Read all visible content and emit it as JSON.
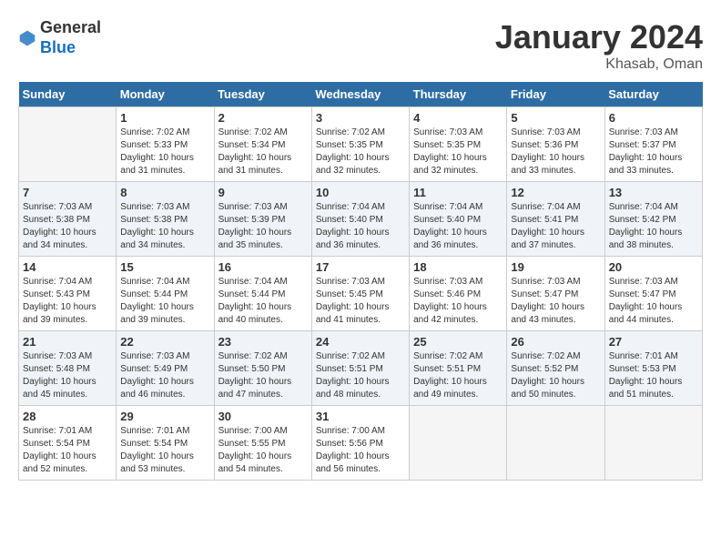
{
  "header": {
    "logo_line1": "General",
    "logo_line2": "Blue",
    "month_year": "January 2024",
    "location": "Khasab, Oman"
  },
  "days_of_week": [
    "Sunday",
    "Monday",
    "Tuesday",
    "Wednesday",
    "Thursday",
    "Friday",
    "Saturday"
  ],
  "weeks": [
    [
      {
        "day": "",
        "sunrise": "",
        "sunset": "",
        "daylight": ""
      },
      {
        "day": "1",
        "sunrise": "Sunrise: 7:02 AM",
        "sunset": "Sunset: 5:33 PM",
        "daylight": "Daylight: 10 hours and 31 minutes."
      },
      {
        "day": "2",
        "sunrise": "Sunrise: 7:02 AM",
        "sunset": "Sunset: 5:34 PM",
        "daylight": "Daylight: 10 hours and 31 minutes."
      },
      {
        "day": "3",
        "sunrise": "Sunrise: 7:02 AM",
        "sunset": "Sunset: 5:35 PM",
        "daylight": "Daylight: 10 hours and 32 minutes."
      },
      {
        "day": "4",
        "sunrise": "Sunrise: 7:03 AM",
        "sunset": "Sunset: 5:35 PM",
        "daylight": "Daylight: 10 hours and 32 minutes."
      },
      {
        "day": "5",
        "sunrise": "Sunrise: 7:03 AM",
        "sunset": "Sunset: 5:36 PM",
        "daylight": "Daylight: 10 hours and 33 minutes."
      },
      {
        "day": "6",
        "sunrise": "Sunrise: 7:03 AM",
        "sunset": "Sunset: 5:37 PM",
        "daylight": "Daylight: 10 hours and 33 minutes."
      }
    ],
    [
      {
        "day": "7",
        "sunrise": "Sunrise: 7:03 AM",
        "sunset": "Sunset: 5:38 PM",
        "daylight": "Daylight: 10 hours and 34 minutes."
      },
      {
        "day": "8",
        "sunrise": "Sunrise: 7:03 AM",
        "sunset": "Sunset: 5:38 PM",
        "daylight": "Daylight: 10 hours and 34 minutes."
      },
      {
        "day": "9",
        "sunrise": "Sunrise: 7:03 AM",
        "sunset": "Sunset: 5:39 PM",
        "daylight": "Daylight: 10 hours and 35 minutes."
      },
      {
        "day": "10",
        "sunrise": "Sunrise: 7:04 AM",
        "sunset": "Sunset: 5:40 PM",
        "daylight": "Daylight: 10 hours and 36 minutes."
      },
      {
        "day": "11",
        "sunrise": "Sunrise: 7:04 AM",
        "sunset": "Sunset: 5:40 PM",
        "daylight": "Daylight: 10 hours and 36 minutes."
      },
      {
        "day": "12",
        "sunrise": "Sunrise: 7:04 AM",
        "sunset": "Sunset: 5:41 PM",
        "daylight": "Daylight: 10 hours and 37 minutes."
      },
      {
        "day": "13",
        "sunrise": "Sunrise: 7:04 AM",
        "sunset": "Sunset: 5:42 PM",
        "daylight": "Daylight: 10 hours and 38 minutes."
      }
    ],
    [
      {
        "day": "14",
        "sunrise": "Sunrise: 7:04 AM",
        "sunset": "Sunset: 5:43 PM",
        "daylight": "Daylight: 10 hours and 39 minutes."
      },
      {
        "day": "15",
        "sunrise": "Sunrise: 7:04 AM",
        "sunset": "Sunset: 5:44 PM",
        "daylight": "Daylight: 10 hours and 39 minutes."
      },
      {
        "day": "16",
        "sunrise": "Sunrise: 7:04 AM",
        "sunset": "Sunset: 5:44 PM",
        "daylight": "Daylight: 10 hours and 40 minutes."
      },
      {
        "day": "17",
        "sunrise": "Sunrise: 7:03 AM",
        "sunset": "Sunset: 5:45 PM",
        "daylight": "Daylight: 10 hours and 41 minutes."
      },
      {
        "day": "18",
        "sunrise": "Sunrise: 7:03 AM",
        "sunset": "Sunset: 5:46 PM",
        "daylight": "Daylight: 10 hours and 42 minutes."
      },
      {
        "day": "19",
        "sunrise": "Sunrise: 7:03 AM",
        "sunset": "Sunset: 5:47 PM",
        "daylight": "Daylight: 10 hours and 43 minutes."
      },
      {
        "day": "20",
        "sunrise": "Sunrise: 7:03 AM",
        "sunset": "Sunset: 5:47 PM",
        "daylight": "Daylight: 10 hours and 44 minutes."
      }
    ],
    [
      {
        "day": "21",
        "sunrise": "Sunrise: 7:03 AM",
        "sunset": "Sunset: 5:48 PM",
        "daylight": "Daylight: 10 hours and 45 minutes."
      },
      {
        "day": "22",
        "sunrise": "Sunrise: 7:03 AM",
        "sunset": "Sunset: 5:49 PM",
        "daylight": "Daylight: 10 hours and 46 minutes."
      },
      {
        "day": "23",
        "sunrise": "Sunrise: 7:02 AM",
        "sunset": "Sunset: 5:50 PM",
        "daylight": "Daylight: 10 hours and 47 minutes."
      },
      {
        "day": "24",
        "sunrise": "Sunrise: 7:02 AM",
        "sunset": "Sunset: 5:51 PM",
        "daylight": "Daylight: 10 hours and 48 minutes."
      },
      {
        "day": "25",
        "sunrise": "Sunrise: 7:02 AM",
        "sunset": "Sunset: 5:51 PM",
        "daylight": "Daylight: 10 hours and 49 minutes."
      },
      {
        "day": "26",
        "sunrise": "Sunrise: 7:02 AM",
        "sunset": "Sunset: 5:52 PM",
        "daylight": "Daylight: 10 hours and 50 minutes."
      },
      {
        "day": "27",
        "sunrise": "Sunrise: 7:01 AM",
        "sunset": "Sunset: 5:53 PM",
        "daylight": "Daylight: 10 hours and 51 minutes."
      }
    ],
    [
      {
        "day": "28",
        "sunrise": "Sunrise: 7:01 AM",
        "sunset": "Sunset: 5:54 PM",
        "daylight": "Daylight: 10 hours and 52 minutes."
      },
      {
        "day": "29",
        "sunrise": "Sunrise: 7:01 AM",
        "sunset": "Sunset: 5:54 PM",
        "daylight": "Daylight: 10 hours and 53 minutes."
      },
      {
        "day": "30",
        "sunrise": "Sunrise: 7:00 AM",
        "sunset": "Sunset: 5:55 PM",
        "daylight": "Daylight: 10 hours and 54 minutes."
      },
      {
        "day": "31",
        "sunrise": "Sunrise: 7:00 AM",
        "sunset": "Sunset: 5:56 PM",
        "daylight": "Daylight: 10 hours and 56 minutes."
      },
      {
        "day": "",
        "sunrise": "",
        "sunset": "",
        "daylight": ""
      },
      {
        "day": "",
        "sunrise": "",
        "sunset": "",
        "daylight": ""
      },
      {
        "day": "",
        "sunrise": "",
        "sunset": "",
        "daylight": ""
      }
    ]
  ]
}
